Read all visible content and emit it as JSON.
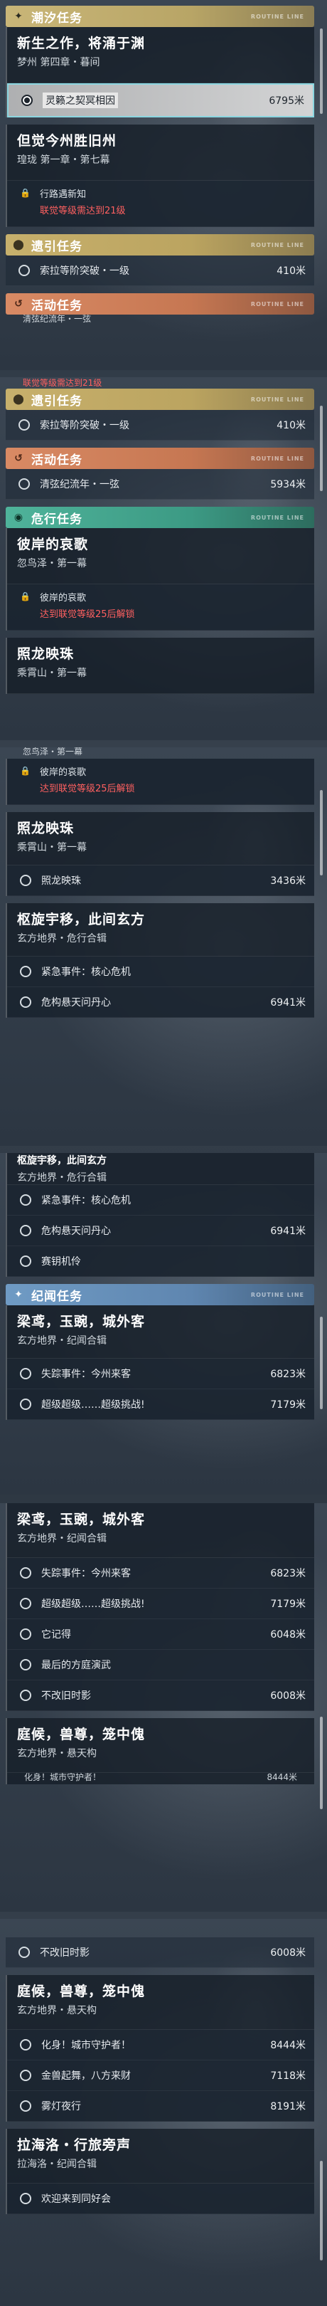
{
  "colors": {
    "main": "#c9b678",
    "guide": "#c7b06c",
    "activity": "#d98a64",
    "danger": "#4fb39a",
    "legend": "#6f9bc4",
    "locked": "#ff6060",
    "highlight": "#8bd6e0"
  },
  "cat_right_text": "ROUTINE LINE",
  "cats": {
    "main": "潮汐任务",
    "guide": "遗引任务",
    "activity": "活动任务",
    "danger": "危行任务",
    "legend": "纪闻任务"
  },
  "quests": {
    "q1": {
      "title": "新生之作，将涌于渊",
      "sub": "梦州 第四章・暮间",
      "task": "灵籁之契冥相因",
      "dist": "6795米"
    },
    "q2": {
      "title": "但觉今州胜旧州",
      "sub": "瑝珑 第一章・第七幕",
      "lock_task": "行路遇新知",
      "lock_req": "联觉等级需达到21级"
    },
    "guide1": {
      "task": "索拉等阶突破・一级",
      "dist": "410米"
    },
    "activity1": {
      "task": "清弦纪流年・一弦",
      "dist": "5934米",
      "peek": "清弦纪流年・一弦"
    },
    "q3": {
      "title": "彼岸的哀歌",
      "sub": "忽鸟泽・第一幕",
      "lock_task": "彼岸的哀歌",
      "lock_req": "达到联觉等级25后解锁"
    },
    "q4": {
      "title": "照龙映珠",
      "sub": "乘霄山・第一幕",
      "task": "照龙映珠",
      "dist": "3436米"
    },
    "q5": {
      "title": "枢旋宇移，此间玄方",
      "sub": "玄方地界・危行合辑",
      "tasks": [
        {
          "task": "紧急事件：核心危机",
          "dist": ""
        },
        {
          "task": "危构悬天问丹心",
          "dist": "6941米"
        },
        {
          "task": "赛钥机伶",
          "dist": ""
        }
      ]
    },
    "q6": {
      "title": "梁鸢，玉豌，城外客",
      "sub": "玄方地界・纪闻合辑",
      "tasks": [
        {
          "task": "失踪事件：今州来客",
          "dist": "6823米"
        },
        {
          "task": "超级超级……超级挑战!",
          "dist": "7179米"
        },
        {
          "task": "它记得",
          "dist": "6048米"
        },
        {
          "task": "最后的方庭演武",
          "dist": ""
        },
        {
          "task": "不改旧时影",
          "dist": "6008米"
        }
      ]
    },
    "q7": {
      "title": "庭候，兽尊，笼中傀",
      "sub": "玄方地界・悬天构",
      "tasks": [
        {
          "task": "化身！城市守护者！",
          "dist": "8444米"
        },
        {
          "task": "金兽起舞，八方来财",
          "dist": "7118米"
        },
        {
          "task": "雾灯夜行",
          "dist": "8191米"
        }
      ],
      "peek": "化身！城市守护者！",
      "peek_dist": "8444米"
    },
    "q8": {
      "title": "拉海洛・行旅旁声",
      "sub": "拉海洛・纪闻合辑",
      "task": "欢迎来到同好会"
    },
    "q3peek": {
      "title": "忽鸟泽・第一幕"
    },
    "q5peek": {
      "title": "枢旋宇移，此间玄方"
    }
  }
}
